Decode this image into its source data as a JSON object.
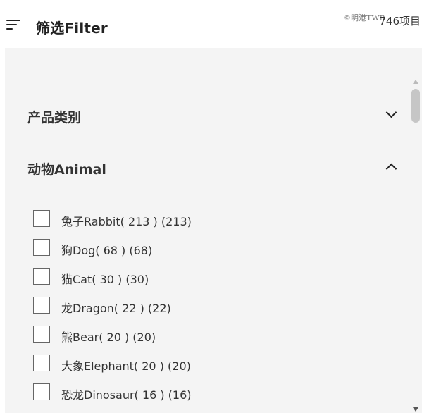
{
  "header": {
    "title": "筛选Filter",
    "watermark": "©明港TWB",
    "item_count": "746项目"
  },
  "sections": [
    {
      "title": "产品类别",
      "expanded": false
    },
    {
      "title": "动物Animal",
      "expanded": true
    }
  ],
  "animal_options": [
    {
      "label": "兔子Rabbit( 213 ) (213)",
      "checked": false
    },
    {
      "label": "狗Dog( 68 ) (68)",
      "checked": false
    },
    {
      "label": "猫Cat( 30 ) (30)",
      "checked": false
    },
    {
      "label": "龙Dragon( 22 ) (22)",
      "checked": false
    },
    {
      "label": "熊Bear( 20 ) (20)",
      "checked": false
    },
    {
      "label": "大象Elephant( 20 ) (20)",
      "checked": false
    },
    {
      "label": "恐龙Dinosaur( 16 ) (16)",
      "checked": false
    }
  ],
  "colors": {
    "panel_bg": "#f4f4f4",
    "header_bg": "#ffffff",
    "text": "#333333"
  }
}
